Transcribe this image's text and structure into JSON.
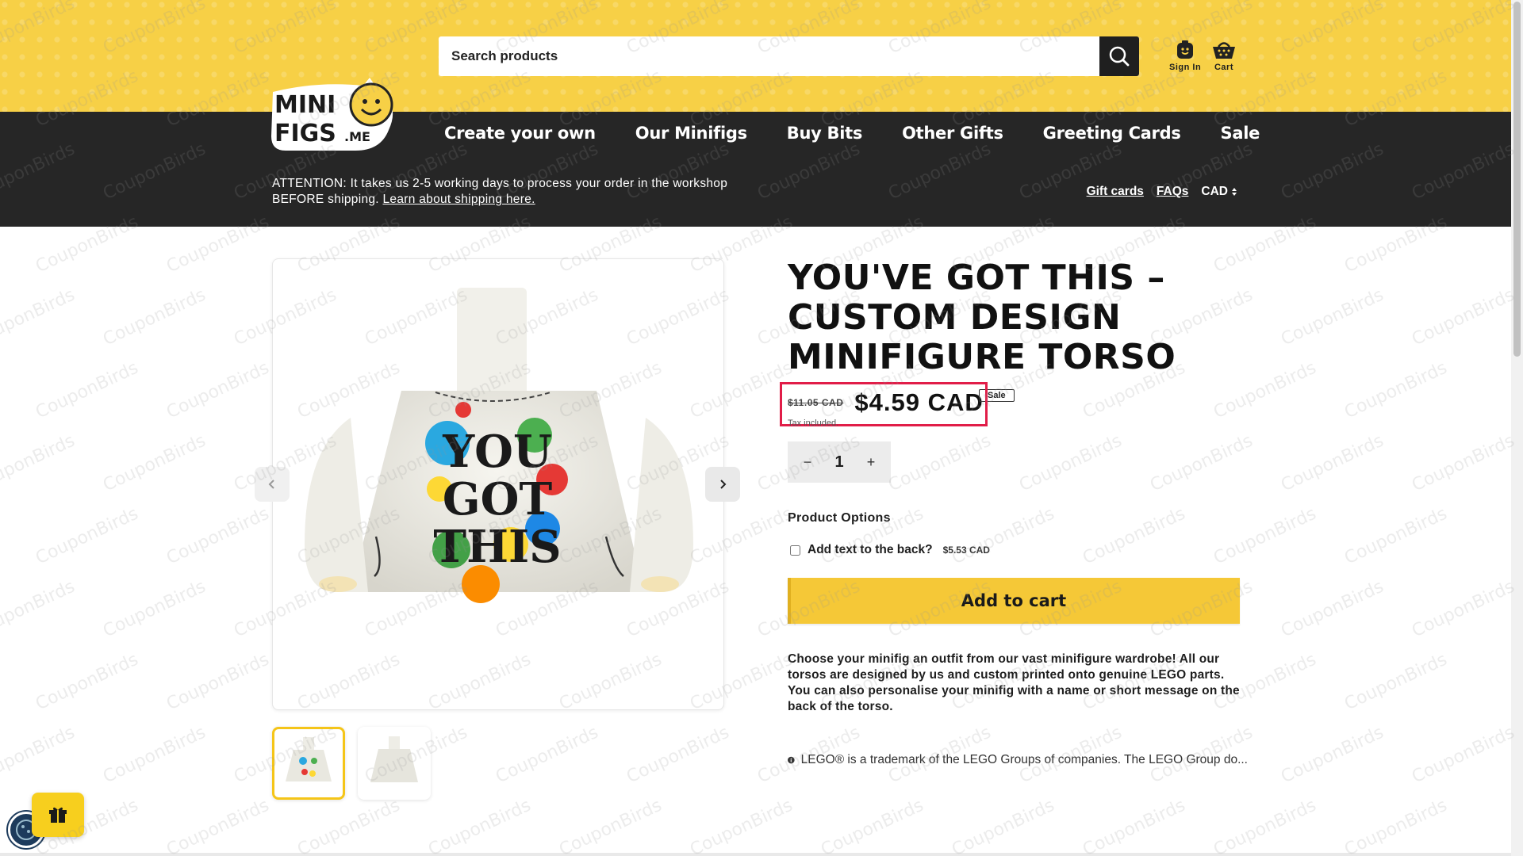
{
  "header": {
    "search_placeholder": "Search products",
    "sign_in_label": "Sign In",
    "cart_label": "Cart"
  },
  "logo": {
    "line1": "MINI",
    "line2": "FIGS",
    "suffix": ".ME"
  },
  "nav": {
    "items": [
      {
        "label": "Create your own"
      },
      {
        "label": "Our Minifigs"
      },
      {
        "label": "Buy Bits"
      },
      {
        "label": "Other Gifts"
      },
      {
        "label": "Greeting Cards"
      },
      {
        "label": "Sale"
      }
    ]
  },
  "notice": {
    "text": "ATTENTION: It takes us 2-5 working days to process your order in the workshop BEFORE shipping. ",
    "link": "Learn about shipping here."
  },
  "utility": {
    "gift_cards": "Gift cards",
    "faqs": "FAQs",
    "currency": "CAD"
  },
  "product": {
    "title": "YOU'VE GOT THIS – CUSTOM DESIGN MINIFIGURE TORSO",
    "price_old": "$11.05 CAD",
    "price_new": "$4.59 CAD",
    "sale_badge": "Sale",
    "tax_note": "Tax included.",
    "quantity": "1",
    "options_heading": "Product Options",
    "option_label": "Add text to the back?",
    "option_price": "$5.53 CAD",
    "add_to_cart": "Add to cart",
    "description": "Choose your minifig an outfit from our vast minifigure wardrobe! All our torsos are designed by us and custom printed onto genuine LEGO parts. You can also personalise your minifig with a name or short message on the back of the torso.",
    "disclaimer": "LEGO® is a trademark of the LEGO Groups of companies. The LEGO Group do...",
    "torso_print": [
      "YOU",
      "GOT",
      "THIS"
    ]
  },
  "watermark": "CouponBirds",
  "colors": {
    "header_yellow": "#f7d046",
    "nav_dark": "#262626",
    "button_yellow": "#f5c837",
    "highlight_red": "#e11d48"
  }
}
